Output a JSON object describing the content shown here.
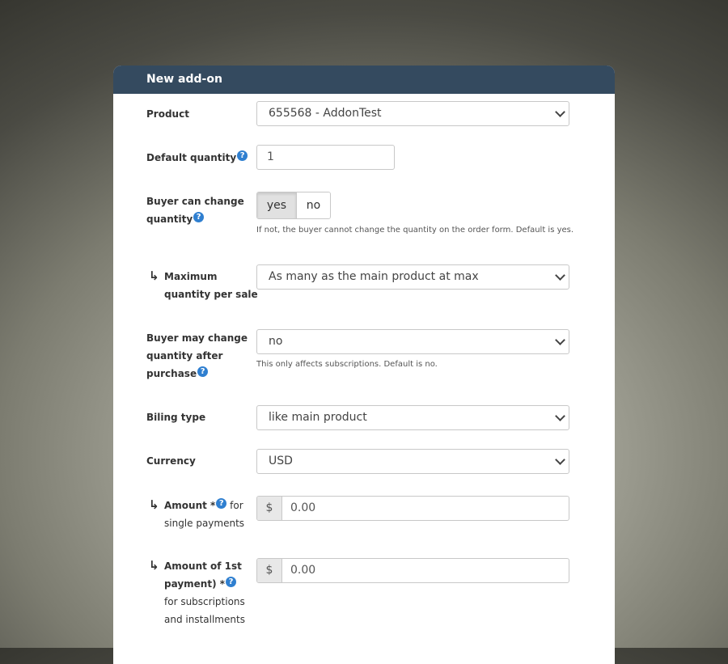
{
  "dialog": {
    "title": "New add-on"
  },
  "fields": {
    "product": {
      "label": "Product",
      "selected": "655568 - AddonTest"
    },
    "default_quantity": {
      "label": "Default quantity",
      "value": "1"
    },
    "buyer_can_change_quantity": {
      "label_line1": "Buyer can change",
      "label_line2": "quantity",
      "options": [
        "yes",
        "no"
      ],
      "selected": "yes",
      "hint": "If not, the buyer cannot change the quantity on the order form. Default is yes."
    },
    "max_quantity_per_sale": {
      "label_line1": "Maximum",
      "label_line2": "quantity per sale",
      "selected": "As many as the main product at max"
    },
    "buyer_may_change_after_purchase": {
      "label_line1": "Buyer may change",
      "label_line2": "quantity after",
      "label_line3": "purchase",
      "selected": "no",
      "hint": "This only affects subscriptions. Default is no."
    },
    "billing_type": {
      "label": "Biling type",
      "selected": "like main product"
    },
    "currency": {
      "label": "Currency",
      "selected": "USD"
    },
    "amount_single": {
      "label": "Amount *",
      "suffix": " for",
      "label_line2": "single payments",
      "prefix": "$",
      "value": "0.00"
    },
    "amount_first_payment": {
      "label_line1": "Amount of 1st",
      "label_line2": "payment) *",
      "label_line3": "for subscriptions",
      "label_line4": "and installments",
      "prefix": "$",
      "value": "0.00"
    }
  },
  "icons": {
    "help": "?",
    "indent_arrow": "↳"
  },
  "colors": {
    "header_bg": "#344a5f",
    "help_icon": "#2f7fd0"
  }
}
